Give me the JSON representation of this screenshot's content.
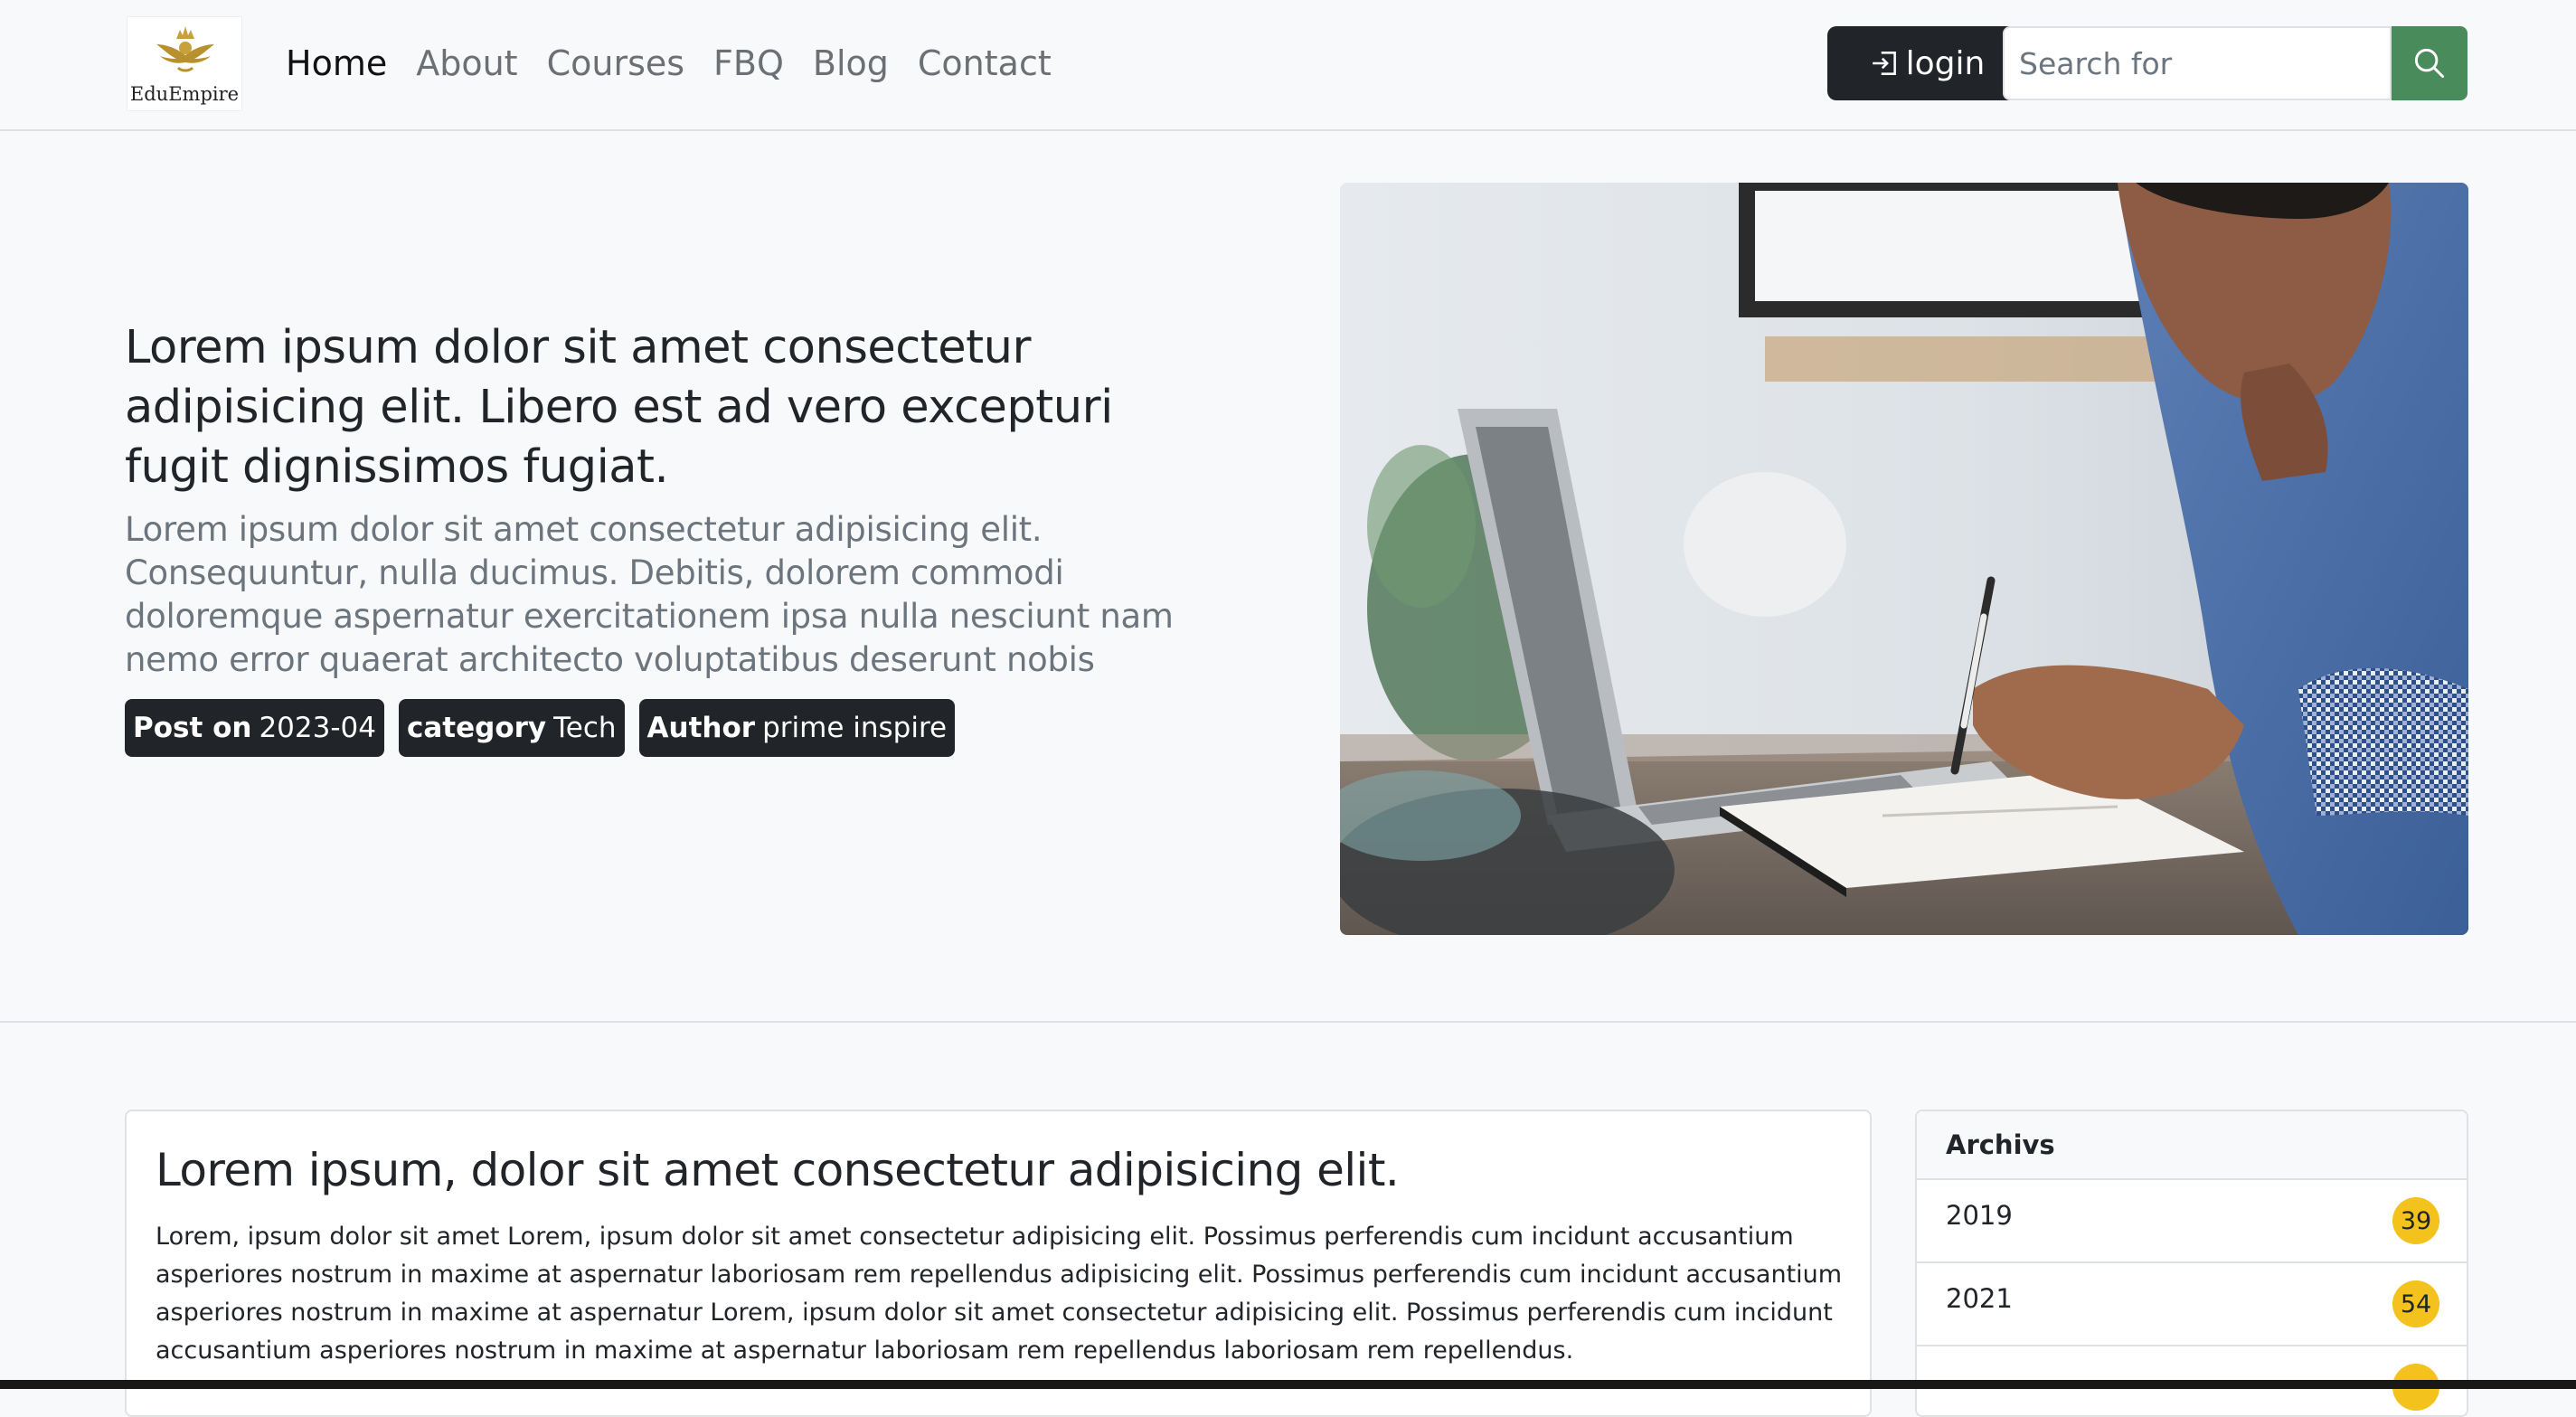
{
  "nav": {
    "logo_text": "EduEmpire",
    "links": [
      "Home",
      "About",
      "Courses",
      "FBQ",
      "Blog",
      "Contact"
    ],
    "active": "Home",
    "login_label": "login",
    "login_icon": "login-arrow-icon",
    "search_placeholder": "Search for",
    "search_icon": "search-icon"
  },
  "hero": {
    "title": "Lorem ipsum dolor sit amet consectetur adipisicing elit. Libero est ad vero excepturi fugit dignissimos fugiat.",
    "lead": "Lorem ipsum dolor sit amet consectetur adipisicing elit. Consequuntur, nulla ducimus. Debitis, dolorem commodi doloremque aspernatur exercitationem ipsa nulla nesciunt nam nemo error quaerat architecto voluptatibus deserunt nobis",
    "badges": [
      {
        "label": "Post on",
        "value": "2023-04"
      },
      {
        "label": "category",
        "value": "Tech"
      },
      {
        "label": "Author",
        "value": "prime inspire"
      }
    ]
  },
  "article": {
    "title": "Lorem ipsum, dolor sit amet consectetur adipisicing elit.",
    "body": "Lorem, ipsum dolor sit amet Lorem, ipsum dolor sit amet consectetur adipisicing elit. Possimus perferendis cum incidunt accusantium asperiores nostrum in maxime at aspernatur laboriosam rem repellendus adipisicing elit. Possimus perferendis cum incidunt accusantium asperiores nostrum in maxime at aspernatur Lorem, ipsum dolor sit amet consectetur adipisicing elit. Possimus perferendis cum incidunt accusantium asperiores nostrum in maxime at aspernatur laboriosam rem repellendus laboriosam rem repellendus."
  },
  "archives": {
    "title": "Archivs",
    "items": [
      {
        "year": "2019",
        "count": "39"
      },
      {
        "year": "2021",
        "count": "54"
      }
    ]
  },
  "colors": {
    "dark": "#212529",
    "search_button": "#4a8b5c",
    "badge_count": "#f4c21c",
    "muted_text": "#6c757d"
  }
}
